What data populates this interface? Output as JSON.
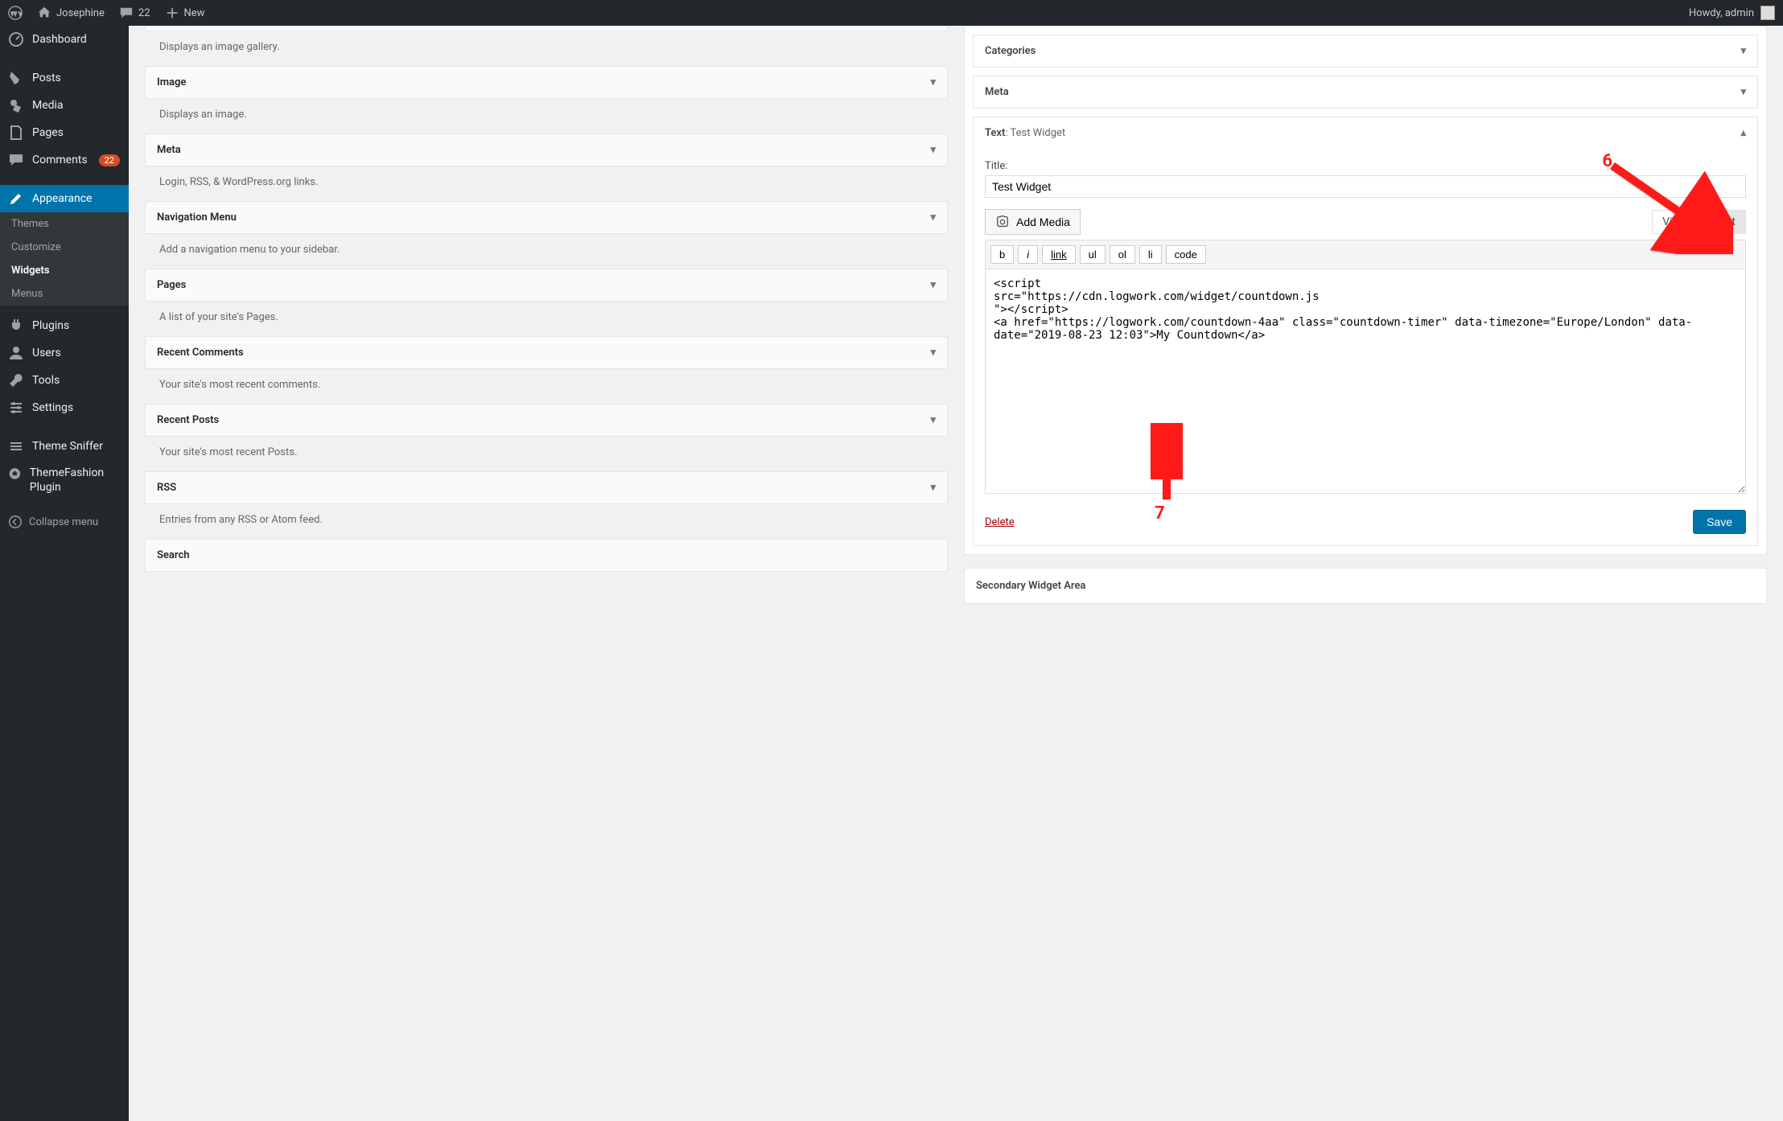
{
  "adminbar": {
    "site_name": "Josephine",
    "comments_count": "22",
    "new_label": "New",
    "howdy": "Howdy, admin"
  },
  "sidebar": {
    "items": [
      {
        "label": "Dashboard"
      },
      {
        "label": "Posts"
      },
      {
        "label": "Media"
      },
      {
        "label": "Pages"
      },
      {
        "label": "Comments",
        "badge": "22"
      },
      {
        "label": "Appearance",
        "current": true
      },
      {
        "label": "Plugins"
      },
      {
        "label": "Users"
      },
      {
        "label": "Tools"
      },
      {
        "label": "Settings"
      },
      {
        "label": "Theme Sniffer"
      },
      {
        "label": "ThemeFashion Plugin"
      }
    ],
    "submenu": [
      {
        "label": "Themes"
      },
      {
        "label": "Customize"
      },
      {
        "label": "Widgets",
        "current": true
      },
      {
        "label": "Menus"
      }
    ],
    "collapse": "Collapse menu"
  },
  "available_widgets": [
    {
      "desc": "Displays an image gallery."
    },
    {
      "title": "Image",
      "desc": "Displays an image."
    },
    {
      "title": "Meta",
      "desc": "Login, RSS, & WordPress.org links."
    },
    {
      "title": "Navigation Menu",
      "desc": "Add a navigation menu to your sidebar."
    },
    {
      "title": "Pages",
      "desc": "A list of your site's Pages."
    },
    {
      "title": "Recent Comments",
      "desc": "Your site's most recent comments."
    },
    {
      "title": "Recent Posts",
      "desc": "Your site's most recent Posts."
    },
    {
      "title": "RSS",
      "desc": "Entries from any RSS or Atom feed."
    },
    {
      "title": "Search"
    }
  ],
  "area": {
    "categories": {
      "title": "Categories"
    },
    "meta": {
      "title": "Meta"
    },
    "text": {
      "title": "Text",
      "subtitle": ": Test Widget",
      "title_label": "Title:",
      "title_value": "Test Widget",
      "add_media": "Add Media",
      "tab_visual": "Visual",
      "tab_text": "Text",
      "buttons": {
        "b": "b",
        "i": "i",
        "link": "link",
        "ul": "ul",
        "ol": "ol",
        "li": "li",
        "code": "code"
      },
      "content": "<script\nsrc=\"https://cdn.logwork.com/widget/countdown.js\n\"></script>\n<a href=\"https://logwork.com/countdown-4aa\" class=\"countdown-timer\" data-timezone=\"Europe/London\" data-date=\"2019-08-23 12:03\">My Countdown</a>",
      "delete": "Delete",
      "save": "Save"
    },
    "secondary": "Secondary Widget Area"
  },
  "annotations": {
    "n6": "6",
    "n7": "7"
  }
}
